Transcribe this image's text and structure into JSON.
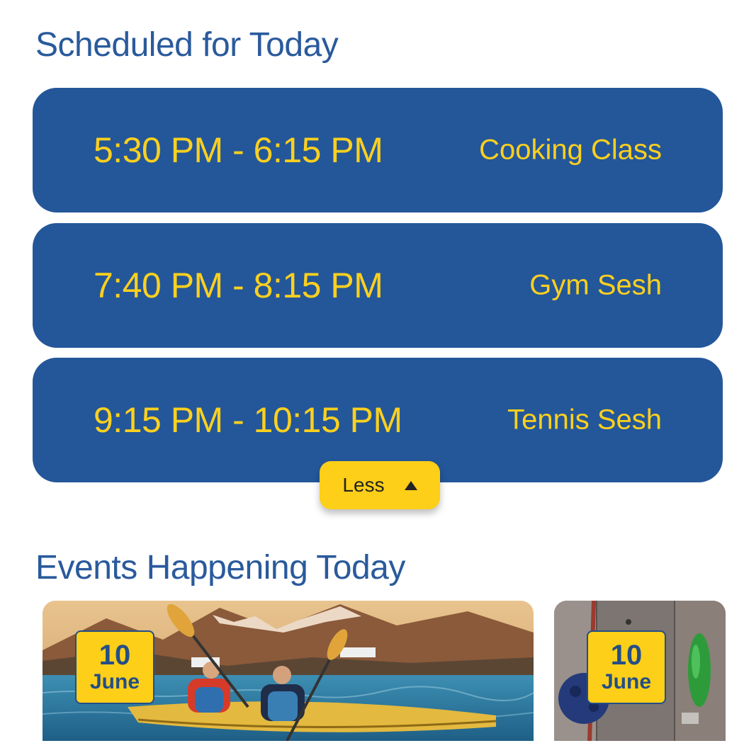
{
  "schedule": {
    "title": "Scheduled for Today",
    "items": [
      {
        "time": "5:30 PM - 6:15 PM",
        "name": "Cooking Class"
      },
      {
        "time": "7:40 PM - 8:15 PM",
        "name": "Gym Sesh"
      },
      {
        "time": "9:15 PM - 10:15 PM",
        "name": "Tennis Sesh"
      }
    ],
    "toggle_label": "Less",
    "toggle_icon": "triangle-up-icon"
  },
  "events": {
    "title": "Events Happening Today",
    "cards": [
      {
        "day": "10",
        "month": "June",
        "image": "kayaking-photo"
      },
      {
        "day": "10",
        "month": "June",
        "image": "climbing-wall-photo"
      }
    ]
  },
  "colors": {
    "primary_blue": "#245799",
    "title_blue": "#2a5a9c",
    "accent_yellow": "#fdd01e"
  }
}
